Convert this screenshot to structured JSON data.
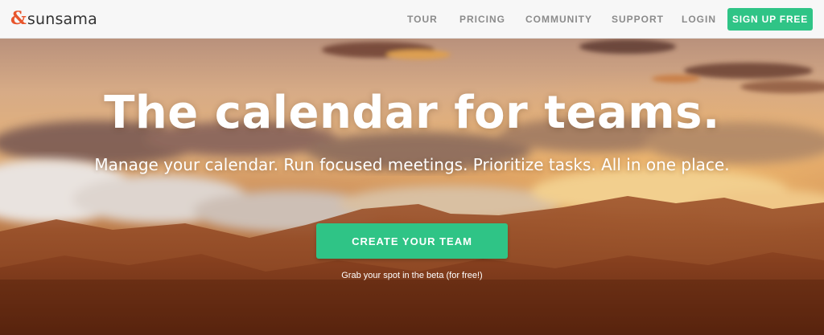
{
  "brand": {
    "mark": "&",
    "name": "sunsama",
    "mark_color": "#e8552c"
  },
  "nav": {
    "tour": "TOUR",
    "pricing": "PRICING",
    "community": "COMMUNITY",
    "support": "SUPPORT",
    "login": "LOGIN",
    "signup": "SIGN UP FREE"
  },
  "hero": {
    "title": "The calendar for teams.",
    "subtitle": "Manage your calendar. Run focused meetings. Prioritize tasks. All in one place.",
    "cta": "CREATE YOUR TEAM",
    "cta_note": "Grab your spot in the beta (for free!)"
  },
  "colors": {
    "accent_green": "#2fc486",
    "nav_background": "#f7f7f7",
    "nav_text": "#8b8b8b"
  }
}
